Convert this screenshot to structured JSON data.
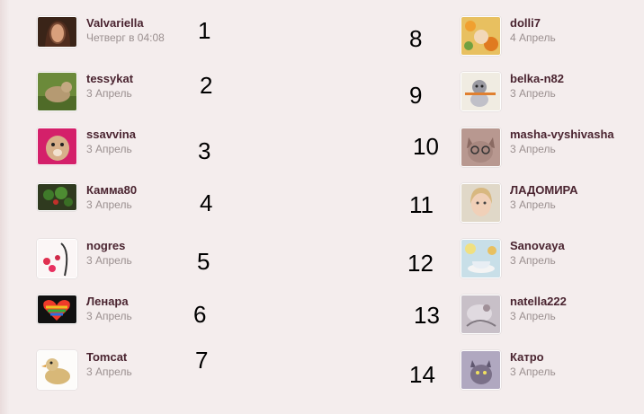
{
  "users": [
    {
      "name": "Valvariella",
      "date": "Четверг в 04:08",
      "num": "1"
    },
    {
      "name": "tessykat",
      "date": "3 Апрель",
      "num": "2"
    },
    {
      "name": "ssavvina",
      "date": "3 Апрель",
      "num": "3"
    },
    {
      "name": "Камма80",
      "date": "3 Апрель",
      "num": "4"
    },
    {
      "name": "nogres",
      "date": "3 Апрель",
      "num": "5"
    },
    {
      "name": "Ленара",
      "date": "3 Апрель",
      "num": "6"
    },
    {
      "name": "Tomcat",
      "date": "3 Апрель",
      "num": "7"
    },
    {
      "name": "dolli7",
      "date": "4 Апрель",
      "num": "8"
    },
    {
      "name": "belka-n82",
      "date": "3 Апрель",
      "num": "9"
    },
    {
      "name": "masha-vyshivasha",
      "date": "3 Апрель",
      "num": "10"
    },
    {
      "name": "ЛАДОМИРА",
      "date": "3 Апрель",
      "num": "11"
    },
    {
      "name": "Sanovaya",
      "date": "3 Апрель",
      "num": "12"
    },
    {
      "name": "natella222",
      "date": "3 Апрель",
      "num": "13"
    },
    {
      "name": "Катро",
      "date": "3 Апрель",
      "num": "14"
    }
  ]
}
